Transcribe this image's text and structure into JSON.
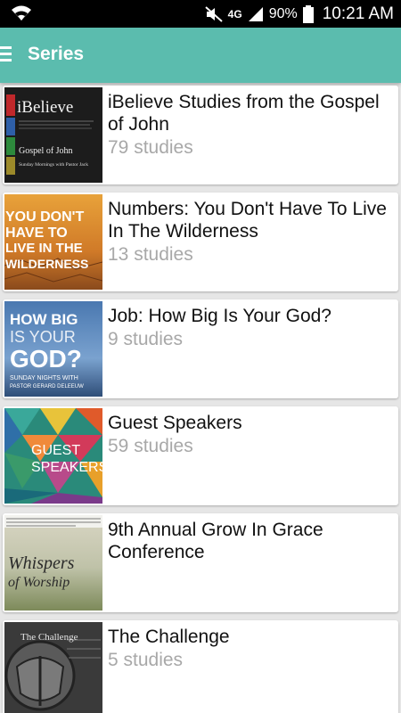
{
  "status_bar": {
    "network": "4G",
    "battery": "90%",
    "time": "10:21 AM"
  },
  "app_bar": {
    "title": "Series"
  },
  "series": [
    {
      "title": "iBelieve Studies from the Gospel of John",
      "count": "79 studies",
      "thumb_text": [
        "iBelieve",
        "Gospel of John",
        "Sunday Mornings with Pastor Jack"
      ]
    },
    {
      "title": "Numbers: You Don't Have To Live In The Wilderness",
      "count": "13 studies",
      "thumb_text": [
        "YOU DON'T",
        "HAVE TO",
        "LIVE IN THE",
        "WILDERNESS"
      ]
    },
    {
      "title": "Job: How Big Is Your God?",
      "count": "9 studies",
      "thumb_text": [
        "HOW BIG",
        "IS YOUR",
        "GOD?",
        "SUNDAY NIGHTS WITH",
        "PASTOR GERARD DELEEUW"
      ]
    },
    {
      "title": "Guest Speakers",
      "count": "59 studies",
      "thumb_text": [
        "GUEST",
        "SPEAKERS"
      ]
    },
    {
      "title": "9th Annual Grow In Grace Conference",
      "count": "",
      "thumb_text": [
        "Whispers",
        "of Worship"
      ]
    },
    {
      "title": "The Challenge",
      "count": "5 studies",
      "thumb_text": [
        "The Challenge"
      ]
    }
  ]
}
